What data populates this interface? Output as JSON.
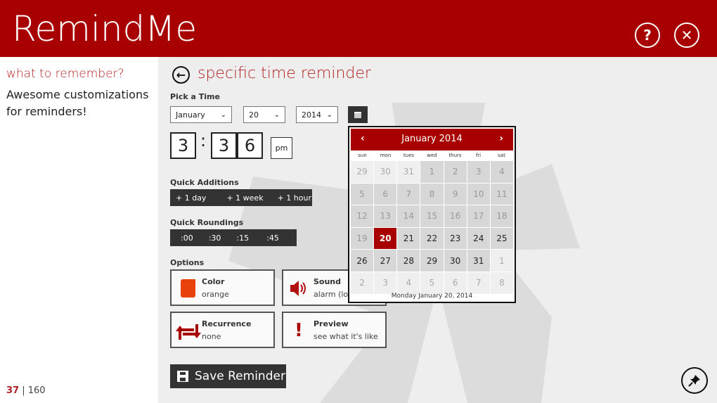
{
  "header": {
    "app_title": "RemindMe",
    "help_icon": "?",
    "close_icon": "✕"
  },
  "left_pane": {
    "heading": "what to remember?",
    "body": "Awesome customizations for reminders!",
    "counter_current": "37",
    "counter_separator": " | ",
    "counter_total": "160"
  },
  "main": {
    "back_icon": "←",
    "title": "specific time reminder",
    "pick_time_label": "Pick a Time",
    "month_select": "January",
    "day_select": "20",
    "year_select": "2014",
    "chevron": "⌄",
    "time": {
      "hour": "3",
      "colon": ":",
      "minute_tens": "3",
      "minute_ones": "6",
      "ampm": "pm"
    },
    "quick_additions_label": "Quick Additions",
    "quick_additions": [
      "+ 1 day",
      "+ 1 week",
      "+ 1 hour"
    ],
    "quick_roundings_label": "Quick Roundings",
    "quick_roundings": [
      ":00",
      ":30",
      ":15",
      ":45"
    ],
    "options_label": "Options",
    "options": {
      "color": {
        "title": "Color",
        "value": "orange",
        "swatch": "#e8420a"
      },
      "sound": {
        "title": "Sound",
        "value": "alarm (long)"
      },
      "recurrence": {
        "title": "Recurrence",
        "value": "none"
      },
      "preview": {
        "title": "Preview",
        "value": "see what it's like"
      }
    },
    "save_label": "Save Reminder"
  },
  "calendar": {
    "prev": "‹",
    "next": "›",
    "title": "January 2014",
    "weekdays": [
      "sun",
      "mon",
      "tues",
      "wed",
      "thurs",
      "fri",
      "sat"
    ],
    "weeks": [
      [
        {
          "d": "29",
          "s": "out"
        },
        {
          "d": "30",
          "s": "out"
        },
        {
          "d": "31",
          "s": "out"
        },
        {
          "d": "1",
          "s": "past"
        },
        {
          "d": "2",
          "s": "past"
        },
        {
          "d": "3",
          "s": "past"
        },
        {
          "d": "4",
          "s": "past"
        }
      ],
      [
        {
          "d": "5",
          "s": "past"
        },
        {
          "d": "6",
          "s": "past"
        },
        {
          "d": "7",
          "s": "past"
        },
        {
          "d": "8",
          "s": "past"
        },
        {
          "d": "9",
          "s": "past"
        },
        {
          "d": "10",
          "s": "past"
        },
        {
          "d": "11",
          "s": "past"
        }
      ],
      [
        {
          "d": "12",
          "s": "past"
        },
        {
          "d": "13",
          "s": "past"
        },
        {
          "d": "14",
          "s": "past"
        },
        {
          "d": "15",
          "s": "past"
        },
        {
          "d": "16",
          "s": "past"
        },
        {
          "d": "17",
          "s": "past"
        },
        {
          "d": "18",
          "s": "past"
        }
      ],
      [
        {
          "d": "19",
          "s": "past"
        },
        {
          "d": "20",
          "s": "sel"
        },
        {
          "d": "21",
          "s": "cur"
        },
        {
          "d": "22",
          "s": "cur"
        },
        {
          "d": "23",
          "s": "cur"
        },
        {
          "d": "24",
          "s": "cur"
        },
        {
          "d": "25",
          "s": "cur"
        }
      ],
      [
        {
          "d": "26",
          "s": "cur"
        },
        {
          "d": "27",
          "s": "cur"
        },
        {
          "d": "28",
          "s": "cur"
        },
        {
          "d": "29",
          "s": "cur"
        },
        {
          "d": "30",
          "s": "cur"
        },
        {
          "d": "31",
          "s": "cur"
        },
        {
          "d": "1",
          "s": "out"
        }
      ],
      [
        {
          "d": "2",
          "s": "out"
        },
        {
          "d": "3",
          "s": "out"
        },
        {
          "d": "4",
          "s": "out"
        },
        {
          "d": "5",
          "s": "out"
        },
        {
          "d": "6",
          "s": "out"
        },
        {
          "d": "7",
          "s": "out"
        },
        {
          "d": "8",
          "s": "out"
        }
      ]
    ],
    "footer": "Monday January 20, 2014"
  },
  "colors": {
    "brand": "#a80000",
    "accent_text": "#b22222",
    "dark_button": "#333333"
  }
}
